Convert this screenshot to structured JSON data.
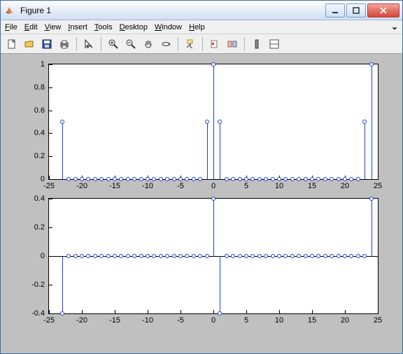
{
  "window": {
    "title": "Figure 1"
  },
  "menubar": {
    "items": [
      {
        "pre": "",
        "key": "F",
        "post": "ile"
      },
      {
        "pre": "",
        "key": "E",
        "post": "dit"
      },
      {
        "pre": "",
        "key": "V",
        "post": "iew"
      },
      {
        "pre": "",
        "key": "I",
        "post": "nsert"
      },
      {
        "pre": "",
        "key": "T",
        "post": "ools"
      },
      {
        "pre": "",
        "key": "D",
        "post": "esktop"
      },
      {
        "pre": "",
        "key": "W",
        "post": "indow"
      },
      {
        "pre": "",
        "key": "H",
        "post": "elp"
      }
    ],
    "right_glyph": "⌄"
  },
  "toolbar": {
    "icons": [
      "new",
      "open",
      "save",
      "print",
      "sep",
      "pointer",
      "sep",
      "zoom-in",
      "zoom-out",
      "pan",
      "rotate",
      "sep",
      "data-cursor",
      "sep",
      "brush",
      "link",
      "sep",
      "colorbar",
      "legend",
      "sep",
      "insert-axes",
      "hide-plot-tools"
    ]
  },
  "chart_data": [
    {
      "type": "stem",
      "title": "",
      "xlabel": "",
      "ylabel": "",
      "xlim": [
        -25,
        25
      ],
      "ylim": [
        0,
        1
      ],
      "xticks": [
        -25,
        -20,
        -15,
        -10,
        -5,
        0,
        5,
        10,
        15,
        20,
        25
      ],
      "yticks": [
        0,
        0.2,
        0.4,
        0.6,
        0.8,
        1
      ],
      "x": [
        -23,
        -22,
        -21,
        -20,
        -19,
        -18,
        -17,
        -16,
        -15,
        -14,
        -13,
        -12,
        -11,
        -10,
        -9,
        -8,
        -7,
        -6,
        -5,
        -4,
        -3,
        -2,
        -1,
        0,
        1,
        2,
        3,
        4,
        5,
        6,
        7,
        8,
        9,
        10,
        11,
        12,
        13,
        14,
        15,
        16,
        17,
        18,
        19,
        20,
        21,
        22,
        23,
        24
      ],
      "y": [
        0.5,
        0,
        0,
        0,
        0,
        0,
        0,
        0,
        0,
        0,
        0,
        0,
        0,
        0,
        0,
        0,
        0,
        0,
        0,
        0,
        0,
        0,
        0.5,
        1,
        0.5,
        0,
        0,
        0,
        0,
        0,
        0,
        0,
        0,
        0,
        0,
        0,
        0,
        0,
        0,
        0,
        0,
        0,
        0,
        0,
        0,
        0,
        0.5,
        1
      ]
    },
    {
      "type": "stem",
      "title": "",
      "xlabel": "",
      "ylabel": "",
      "xlim": [
        -25,
        25
      ],
      "ylim": [
        -0.4,
        0.4
      ],
      "xticks": [
        -25,
        -20,
        -15,
        -10,
        -5,
        0,
        5,
        10,
        15,
        20,
        25
      ],
      "yticks": [
        -0.4,
        -0.2,
        0,
        0.2,
        0.4
      ],
      "x": [
        -23,
        -22,
        -21,
        -20,
        -19,
        -18,
        -17,
        -16,
        -15,
        -14,
        -13,
        -12,
        -11,
        -10,
        -9,
        -8,
        -7,
        -6,
        -5,
        -4,
        -3,
        -2,
        -1,
        0,
        1,
        2,
        3,
        4,
        5,
        6,
        7,
        8,
        9,
        10,
        11,
        12,
        13,
        14,
        15,
        16,
        17,
        18,
        19,
        20,
        21,
        22,
        23,
        24
      ],
      "y": [
        -0.4,
        0,
        0,
        0,
        0,
        0,
        0,
        0,
        0,
        0,
        0,
        0,
        0,
        0,
        0,
        0,
        0,
        0,
        0,
        0,
        0,
        0,
        0,
        0.4,
        -0.4,
        0,
        0,
        0,
        0,
        0,
        0,
        0,
        0,
        0,
        0,
        0,
        0,
        0,
        0,
        0,
        0,
        0,
        0,
        0,
        0,
        0,
        0,
        0.4
      ]
    }
  ],
  "colors": {
    "stem": "#2040d0",
    "figure_bg": "#c0c0c0",
    "axes_bg": "#ffffff"
  }
}
